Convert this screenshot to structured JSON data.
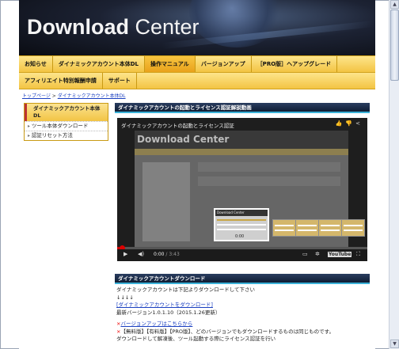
{
  "header": {
    "logo_bold": "Download",
    "logo_light": " Center"
  },
  "nav": {
    "row1": [
      "お知らせ",
      "ダイナミックアカウント本体DL",
      "操作マニュアル",
      "バージョンアップ",
      "［PRO版］ヘアップグレード"
    ],
    "row2": [
      "アフィリエイト特別報酬申請",
      "サポート"
    ],
    "active_index": 2
  },
  "breadcrumb": {
    "home": "トップページ",
    "separator": " > ",
    "current": "ダイナミックアカウント本体DL"
  },
  "sidebar": {
    "heading": "ダイナミックアカウント本体DL",
    "items": [
      "ツール本体ダウンロード",
      "認証リセット方法"
    ]
  },
  "section1": {
    "title": "ダイナミックアカウントの起動とライセンス認証解説動画"
  },
  "video": {
    "title": "ダイナミックアカウントの起動とライセンス認証",
    "screen_logo": "Download Center",
    "thumb_logo": "Download Center",
    "thumb_time": "0:00",
    "current_time": "0:00",
    "duration": " / 3:43",
    "progress_fraction": 0.01,
    "icons": [
      "like-icon",
      "dislike-icon",
      "share-icon",
      "play-icon",
      "volume-icon",
      "captions-icon",
      "settings-icon",
      "youtube-logo",
      "fullscreen-icon"
    ]
  },
  "section2": {
    "title": "ダイナミックアカウントダウンロード"
  },
  "download": {
    "line1": "ダイナミックアカウントは下記よりダウンロードして下さい",
    "arrows": "↓↓↓↓",
    "link": "[ダイナミックアカウントをダウンロード]",
    "version": "最新バージョン1.0.1.10（2015.1.26更新）",
    "note1_star": "×",
    "note1_link": "バージョンアップはこちらから",
    "note2_star": "×",
    "note2_text": "【無料版】【有料版】【PRO版】、どのバージョンでもダウンロードするものは同じものです。",
    "note3_text": "ダウンロードして解凍後、ツール起動する際にライセンス認証を行い"
  },
  "colors": {
    "nav_gold": "#f3c443",
    "section_navy": "#0f1c33",
    "accent_cyan": "#3bb2d8",
    "link_blue": "#1a3fc0",
    "progress_red": "#cc0000"
  }
}
